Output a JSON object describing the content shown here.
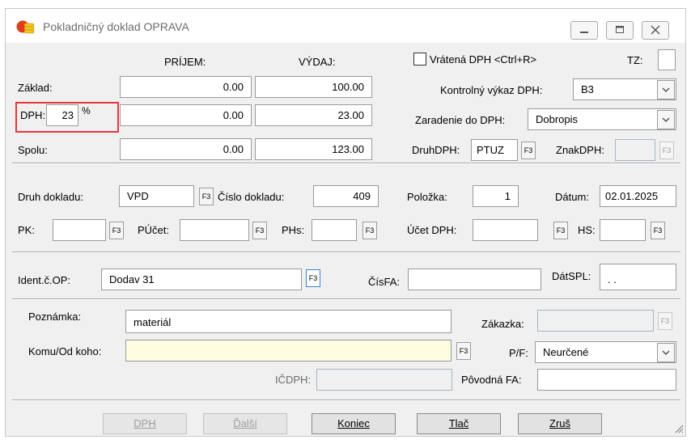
{
  "window": {
    "title": "Pokladničný doklad OPRAVA"
  },
  "amounts": {
    "col_prijem": "PRÍJEM:",
    "col_vydaj": "VÝDAJ:",
    "zaklad_label": "Základ:",
    "dph_label": "DPH:",
    "dph_rate": "23",
    "percent": "%",
    "spolu_label": "Spolu:",
    "zaklad_prijem": "0.00",
    "zaklad_vydaj": "100.00",
    "dph_prijem": "0.00",
    "dph_vydaj": "23.00",
    "spolu_prijem": "0.00",
    "spolu_vydaj": "123.00"
  },
  "vat": {
    "vratena_label": "Vrátená DPH <Ctrl+R>",
    "tz_label": "TZ:",
    "kontrolny_label": "Kontrolný výkaz DPH:",
    "kontrolny_value": "B3",
    "zaradenie_label": "Zaradenie do DPH:",
    "zaradenie_value": "Dobropis",
    "druh_label": "DruhDPH:",
    "druh_value": "PTUZ",
    "znak_label": "ZnakDPH:"
  },
  "doc": {
    "druh_label": "Druh dokladu:",
    "druh_value": "VPD",
    "cislo_label": "Číslo dokladu:",
    "cislo_value": "409",
    "polozka_label": "Položka:",
    "polozka_value": "1",
    "datum_label": "Dátum:",
    "datum_value": "02.01.2025",
    "pk_label": "PK:",
    "pucet_label": "PÚčet:",
    "phs_label": "PHs:",
    "ucet_dph_label": "Účet DPH:",
    "hs_label": "HS:"
  },
  "partner": {
    "ident_label": "Ident.č.OP:",
    "ident_value": "Dodav  31",
    "cisfa_label": "ČísFA:",
    "datspl_label": "DátSPL:",
    "datspl_value": " .  ."
  },
  "notes": {
    "poznamka_label": "Poznámka:",
    "poznamka_value": "materiál",
    "zakazka_label": "Zákazka:",
    "komu_label": "Komu/Od koho:",
    "pf_label": "P/F:",
    "pf_value": "Neurčené",
    "icdph_label": "IČDPH:",
    "povodna_label": "Pôvodná FA:"
  },
  "f3": "F3",
  "buttons": {
    "dph": "DPH",
    "dalsi": "Ďalší",
    "koniec": "Koniec",
    "tlac": "Tlač",
    "zrus": "Zruš"
  },
  "colors": {
    "highlight": "#e5383b",
    "accent": "#3b84d4"
  }
}
